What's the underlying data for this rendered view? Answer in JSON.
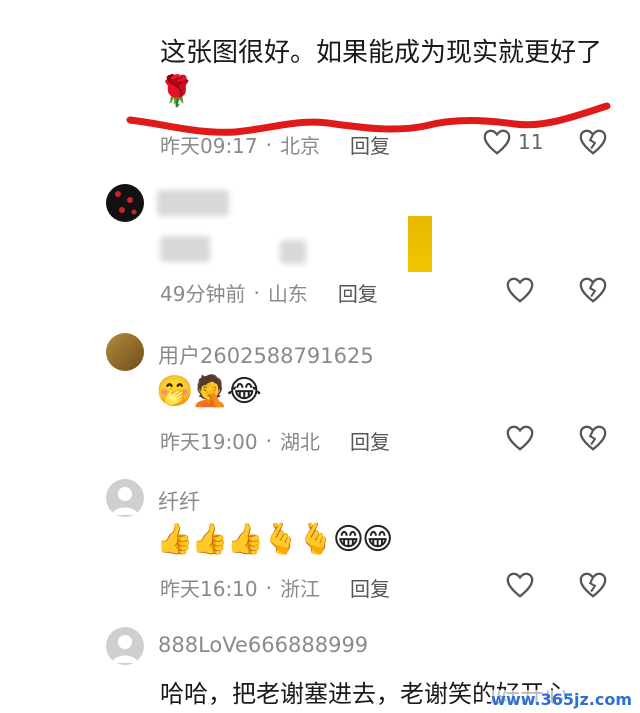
{
  "comments": [
    {
      "text": "这张图很好。如果能成为现实就更好了",
      "emoji": "🌹",
      "time": "昨天09:17",
      "location": "北京",
      "reply_label": "回复",
      "likes": "11"
    },
    {
      "time": "49分钟前",
      "location": "山东",
      "reply_label": "回复"
    },
    {
      "username": "用户2602588791625",
      "emoji": "🤭🤦😂",
      "time": "昨天19:00",
      "location": "湖北",
      "reply_label": "回复"
    },
    {
      "username": "纤纤",
      "emoji": "👍👍👍🫰🫰😁😁",
      "time": "昨天16:10",
      "location": "浙江",
      "reply_label": "回复"
    },
    {
      "username": "888LoVe666888999",
      "text": "哈哈，把老谢塞进去，老谢笑的好开心"
    }
  ],
  "separator": "·",
  "watermark": "www.365jz.com",
  "colors": {
    "annotation_red": "#e01919",
    "heart_gray": "#555555"
  }
}
